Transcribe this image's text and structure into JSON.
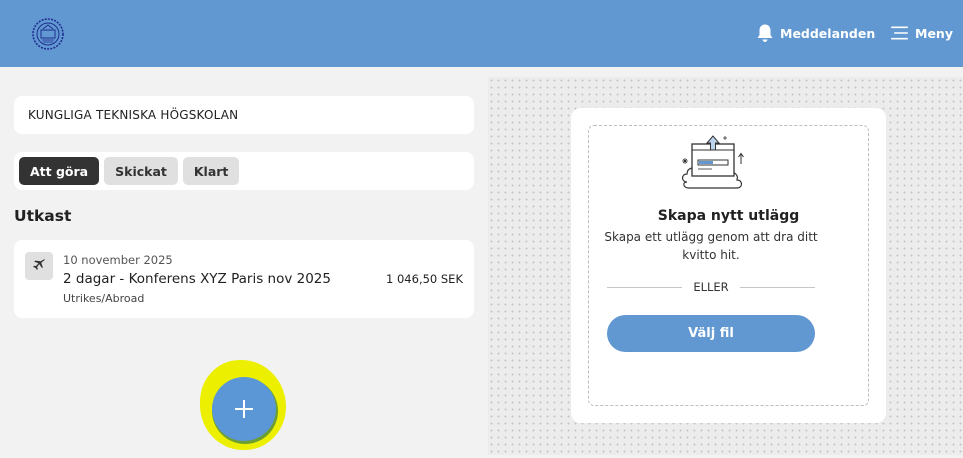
{
  "header": {
    "logo": "kth-logo",
    "notifications_label": "Meddelanden",
    "menu_label": "Meny"
  },
  "organization": "KUNGLIGA TEKNISKA HÖGSKOLAN",
  "tabs": [
    {
      "label": "Att göra",
      "active": true
    },
    {
      "label": "Skickat",
      "active": false
    },
    {
      "label": "Klart",
      "active": false
    }
  ],
  "drafts": {
    "title": "Utkast",
    "items": [
      {
        "icon": "airplane-icon",
        "date": "10 november 2025",
        "title": "2 dagar - Konferens XYZ Paris nov 2025",
        "subtitle": "Utrikes/Abroad",
        "amount": "1 046,50 SEK"
      }
    ]
  },
  "fab": {
    "icon": "plus-icon"
  },
  "upload": {
    "title": "Skapa nytt utlägg",
    "description": "Skapa ett utlägg genom att dra ditt kvitto hit.",
    "or_label": "ELLER",
    "choose_label": "Välj fil"
  },
  "colors": {
    "header_bg": "#6298d2",
    "primary": "#6298d2",
    "fab": "#5b97d6",
    "highlight": "#ecf000",
    "active_tab": "#333333"
  }
}
